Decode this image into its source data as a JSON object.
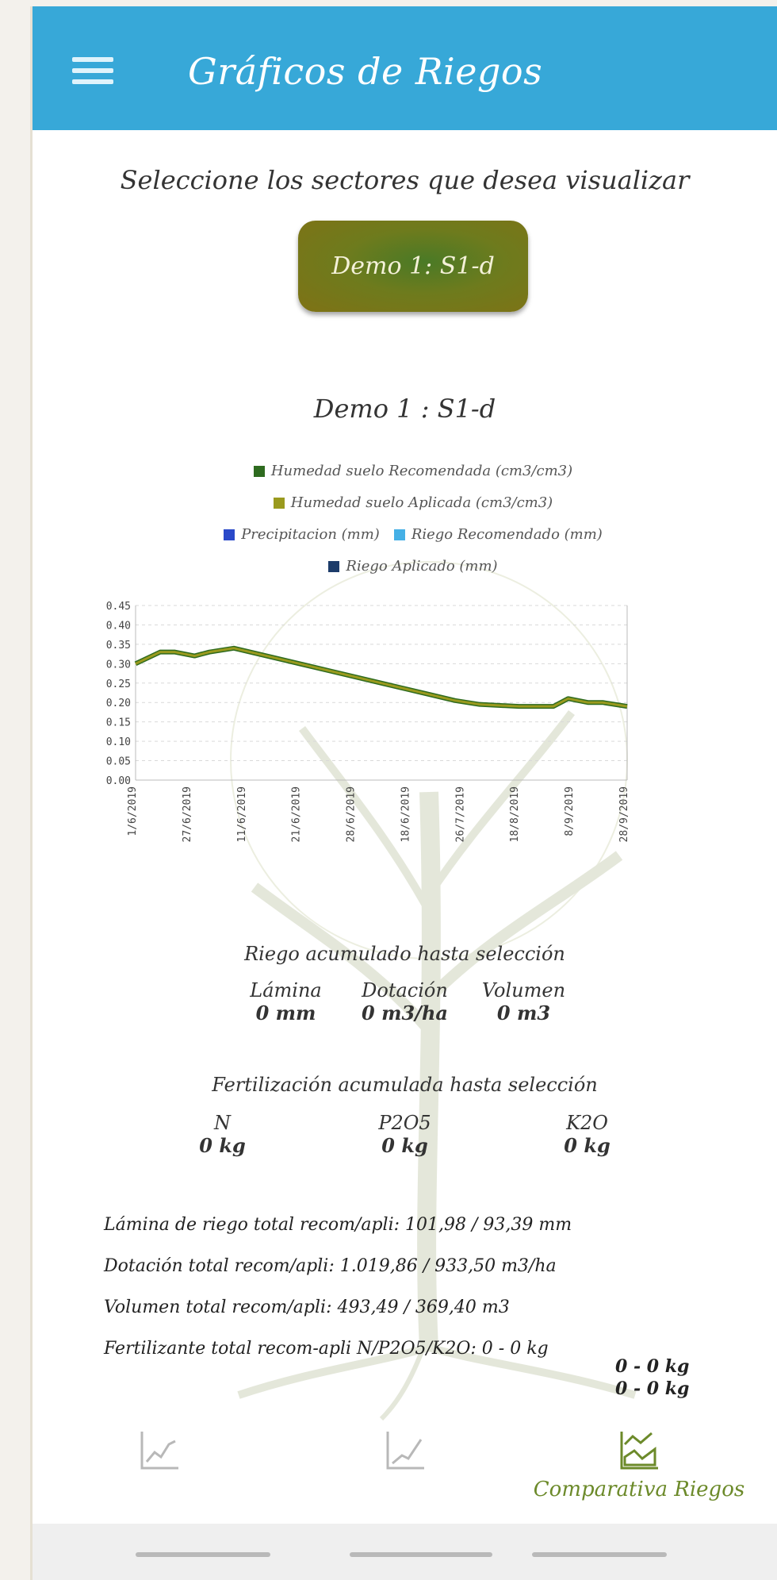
{
  "app": {
    "title": "Gráficos de Riegos"
  },
  "main": {
    "instruction": "Seleccione los sectores que desea visualizar",
    "sector_button_label": "Demo 1: S1-d",
    "chart_title": "Demo 1 : S1-d"
  },
  "chart_data": {
    "type": "line",
    "title": "Demo 1 : S1-d",
    "legend": [
      {
        "label": "Humedad suelo Recomendada (cm3/cm3)",
        "color": "#2e6b1f"
      },
      {
        "label": "Humedad suelo Aplicada (cm3/cm3)",
        "color": "#9a9a1e"
      },
      {
        "label": "Precipitacion (mm)",
        "color": "#2a49c9"
      },
      {
        "label": "Riego Recomendado (mm)",
        "color": "#45b0e6"
      },
      {
        "label": "Riego Aplicado (mm)",
        "color": "#1d3c6a"
      }
    ],
    "legend_position": "top",
    "x_categories": [
      "1/6/2019",
      "27/6/2019",
      "11/6/2019",
      "21/6/2019",
      "28/6/2019",
      "18/6/2019",
      "26/7/2019",
      "18/8/2019",
      "8/9/2019",
      "28/9/2019"
    ],
    "ylim_left": [
      0.0,
      0.45
    ],
    "ylim_right": [
      0,
      10
    ],
    "yticks_left": [
      "0.45",
      "0.40",
      "0.35",
      "0.30",
      "0.25",
      "0.20",
      "0.15",
      "0.10",
      "0.05",
      "0.00"
    ],
    "grid": true,
    "series": [
      {
        "name": "Humedad suelo Recomendada (cm3/cm3)",
        "x": [
          0,
          0.05,
          0.08,
          0.12,
          0.15,
          0.2,
          0.3,
          0.4,
          0.5,
          0.6,
          0.65,
          0.7,
          0.78,
          0.8,
          0.85,
          0.88,
          0.92,
          0.95,
          1.0
        ],
        "y": [
          0.3,
          0.33,
          0.33,
          0.32,
          0.33,
          0.34,
          0.31,
          0.28,
          0.25,
          0.22,
          0.205,
          0.195,
          0.19,
          0.19,
          0.19,
          0.21,
          0.2,
          0.2,
          0.19
        ]
      },
      {
        "name": "Humedad suelo Aplicada (cm3/cm3)",
        "x": [
          0,
          0.05,
          0.08,
          0.12,
          0.15,
          0.2,
          0.3,
          0.4,
          0.5,
          0.6,
          0.65,
          0.7,
          0.78,
          0.8,
          0.85,
          0.88,
          0.92,
          0.95,
          1.0
        ],
        "y": [
          0.3,
          0.33,
          0.33,
          0.32,
          0.33,
          0.34,
          0.31,
          0.28,
          0.25,
          0.22,
          0.205,
          0.195,
          0.19,
          0.19,
          0.19,
          0.21,
          0.2,
          0.2,
          0.19
        ]
      }
    ]
  },
  "riego_section": {
    "heading": "Riego acumulado hasta selección",
    "columns": [
      {
        "label": "Lámina",
        "value": "0 mm"
      },
      {
        "label": "Dotación",
        "value": "0 m3/ha"
      },
      {
        "label": "Volumen",
        "value": "0 m3"
      }
    ]
  },
  "fert_section": {
    "heading": "Fertilización acumulada hasta selección",
    "columns": [
      {
        "label": "N",
        "value": "0 kg"
      },
      {
        "label": "P2O5",
        "value": "0 kg"
      },
      {
        "label": "K2O",
        "value": "0 kg"
      }
    ]
  },
  "totals": {
    "lamina": "Lámina de riego total recom/apli: 101,98 / 93,39 mm",
    "dotacion": "Dotación total recom/apli: 1.019,86 / 933,50 m3/ha",
    "volumen": "Volumen total recom/apli: 493,49 / 369,40 m3",
    "fertilizante": "Fertilizante total recom-apli N/P2O5/K2O: 0 - 0 kg",
    "fert_line2": "0 - 0 kg",
    "fert_line3": "0 - 0 kg"
  },
  "bottom_nav": {
    "items": [
      {
        "icon": "line-chart-icon",
        "label": ""
      },
      {
        "icon": "trend-chart-icon",
        "label": ""
      },
      {
        "icon": "area-chart-icon",
        "label": "Comparativa Riegos"
      }
    ],
    "active_color": "#6c8a2a"
  },
  "colors": {
    "appbar": "#37a8d8",
    "button": "#6e7b1d"
  }
}
